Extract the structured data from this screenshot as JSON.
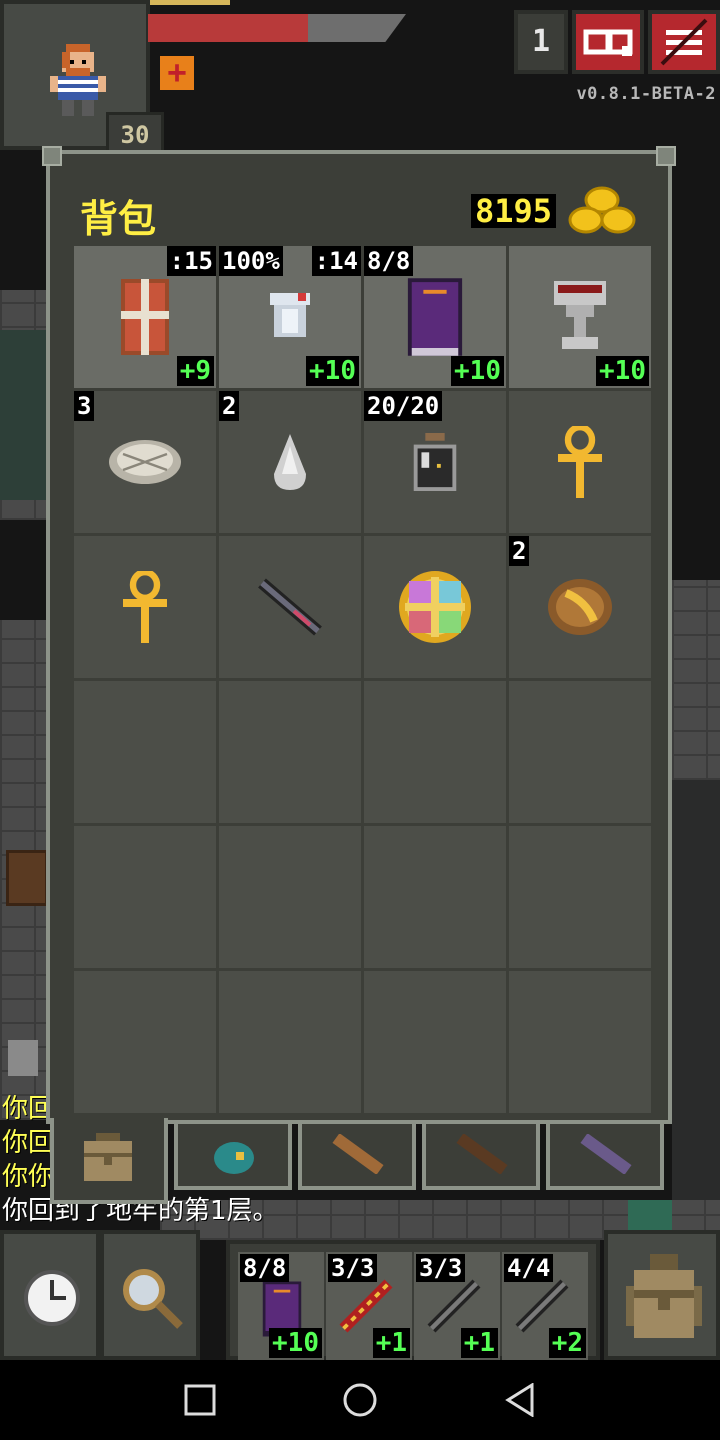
{
  "hud": {
    "level": "30",
    "depth": "1",
    "version": "v0.8.1-BETA-2",
    "hp_fraction": 0.62,
    "exp_fraction": 0.32
  },
  "inventory": {
    "title": "背包",
    "gold": "8195",
    "slots": [
      {
        "name": "armor-item",
        "icon": "shield-icon",
        "top_left": "",
        "top_right": ":15",
        "level": "+9",
        "equip": true
      },
      {
        "name": "cloth-armor-item",
        "icon": "armor-icon",
        "top_left": "100%",
        "top_right": ":14",
        "level": "+10",
        "equip": true
      },
      {
        "name": "spellbook-item",
        "icon": "book-icon",
        "top_left": "8/8",
        "top_right": "",
        "level": "+10",
        "equip": true
      },
      {
        "name": "chalice-item",
        "icon": "chalice-icon",
        "top_left": "",
        "top_right": "",
        "level": "+10",
        "equip": true
      },
      {
        "name": "seed-pouch-item",
        "icon": "pouch-icon",
        "top_left": "3",
        "top_right": "",
        "level": "",
        "equip": false
      },
      {
        "name": "stone-item",
        "icon": "stone-icon",
        "top_left": "2",
        "top_right": "",
        "level": "",
        "equip": false
      },
      {
        "name": "waterskin-item",
        "icon": "flask-icon",
        "top_left": "20/20",
        "top_right": "",
        "level": "",
        "equip": false
      },
      {
        "name": "ankh-item",
        "icon": "ankh-icon",
        "top_left": "",
        "top_right": "",
        "level": "",
        "equip": false
      },
      {
        "name": "ankh-item-2",
        "icon": "ankh-icon",
        "top_left": "",
        "top_right": "",
        "level": "",
        "equip": false
      },
      {
        "name": "wand-item",
        "icon": "wand-icon",
        "top_left": "",
        "top_right": "",
        "level": "",
        "equip": false
      },
      {
        "name": "amulet-item",
        "icon": "amulet-icon",
        "top_left": "",
        "top_right": "",
        "level": "",
        "equip": false
      },
      {
        "name": "scroll-item",
        "icon": "scroll-icon",
        "top_left": "2",
        "top_right": "",
        "level": "",
        "equip": false
      }
    ]
  },
  "log": [
    {
      "text": "你回",
      "color": "yellow"
    },
    {
      "text": "你回",
      "color": "yellow"
    },
    {
      "text": "你你",
      "color": "yellow"
    },
    {
      "text": "你回到了地牢的第1层。",
      "color": "white"
    }
  ],
  "quickslots": [
    {
      "qty": "8/8",
      "level": "+10",
      "icon": "book-icon"
    },
    {
      "qty": "3/3",
      "level": "+1",
      "icon": "fire-wand-icon"
    },
    {
      "qty": "3/3",
      "level": "+1",
      "icon": "wand-icon"
    },
    {
      "qty": "4/4",
      "level": "+2",
      "icon": "wand-icon"
    }
  ],
  "colors": {
    "accent_yellow": "#ffee44",
    "upgrade_green": "#55ff55",
    "hp_red": "#b83a3a",
    "button_red": "#b5282e"
  }
}
